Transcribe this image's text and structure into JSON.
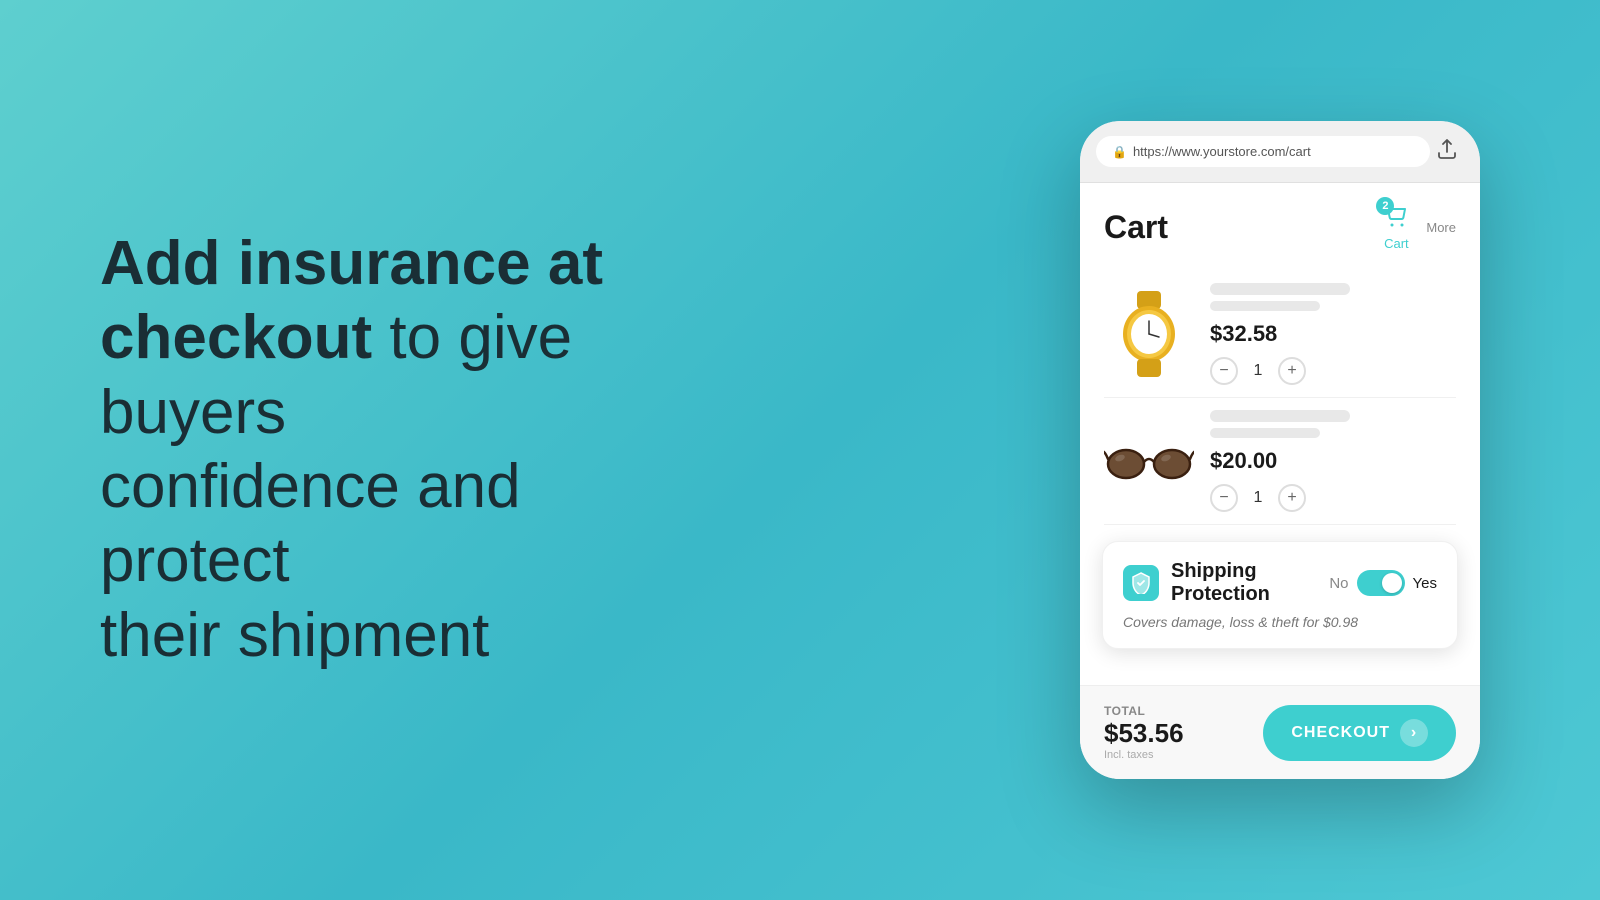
{
  "hero": {
    "line1_bold": "Add insurance at",
    "line2_bold_part": "checkout",
    "line2_normal_part": " to give buyers",
    "line3": "confidence and protect",
    "line4": "their shipment"
  },
  "browser": {
    "url": "https://www.yourstore.com/cart",
    "share_label": "⬆"
  },
  "cart": {
    "title": "Cart",
    "nav": {
      "badge_count": "2",
      "cart_label": "Cart",
      "more_label": "More"
    },
    "items": [
      {
        "id": "watch",
        "price": "$32.58",
        "quantity": "1",
        "emoji": "⌚"
      },
      {
        "id": "sunglasses",
        "price": "$20.00",
        "quantity": "1",
        "emoji": "🕶️"
      }
    ],
    "shipping_protection": {
      "title": "Shipping Protection",
      "no_label": "No",
      "yes_label": "Yes",
      "description": "Covers damage, loss & theft for $0.98",
      "enabled": true
    },
    "footer": {
      "total_label": "TOTAL",
      "total_amount": "$53.56",
      "incl_taxes": "Incl. taxes",
      "checkout_label": "CHECKOUT"
    }
  },
  "icons": {
    "lock": "🔒",
    "cart": "🛒",
    "shield": "🛡",
    "arrow_right": "›",
    "minus": "−",
    "plus": "+"
  }
}
